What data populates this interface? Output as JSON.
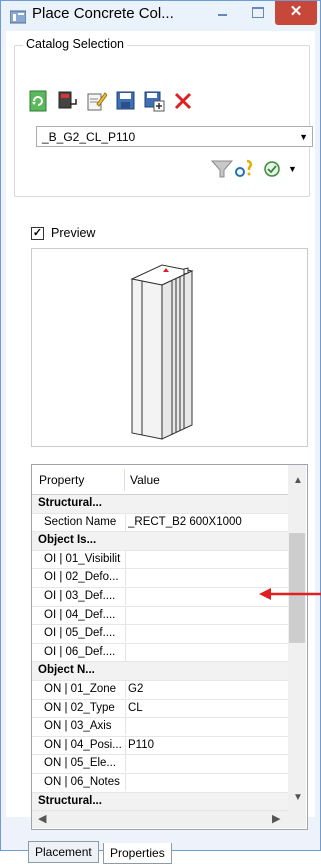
{
  "window": {
    "title": "Place Concrete Col...",
    "close_glyph": "✕"
  },
  "catalog": {
    "legend": "Catalog Selection",
    "selected": "_B_G2_CL_P110",
    "toolbar_icons": [
      "refresh-catalog-icon",
      "catalog-book-icon",
      "edit-catalog-icon",
      "save-icon",
      "save-as-icon",
      "delete-icon"
    ],
    "filter_icons": [
      "funnel-filter-icon",
      "query-icon",
      "options-icon"
    ]
  },
  "preview": {
    "label": "Preview",
    "checked": "✓"
  },
  "grid": {
    "col_property": "Property",
    "col_value": "Value",
    "rows": [
      {
        "type": "cat",
        "name": "Structural...",
        "value": ""
      },
      {
        "type": "prop",
        "name": "Section Name",
        "value": "_RECT_B2 600X1000"
      },
      {
        "type": "cat",
        "name": "Object Is...",
        "value": ""
      },
      {
        "type": "prop",
        "name": "OI | 01_Visibilit",
        "value": ""
      },
      {
        "type": "prop",
        "name": "OI | 02_Defo...",
        "value": ""
      },
      {
        "type": "prop",
        "name": "OI | 03_Def....",
        "value": ""
      },
      {
        "type": "prop",
        "name": "OI | 04_Def....",
        "value": ""
      },
      {
        "type": "prop",
        "name": "OI | 05_Def....",
        "value": ""
      },
      {
        "type": "prop",
        "name": "OI | 06_Def....",
        "value": ""
      },
      {
        "type": "cat",
        "name": "Object N...",
        "value": ""
      },
      {
        "type": "prop",
        "name": "ON | 01_Zone",
        "value": "G2"
      },
      {
        "type": "prop",
        "name": "ON | 02_Type",
        "value": "CL"
      },
      {
        "type": "prop",
        "name": "ON | 03_Axis",
        "value": ""
      },
      {
        "type": "prop",
        "name": "ON | 04_Posi...",
        "value": "P110"
      },
      {
        "type": "prop",
        "name": "ON | 05_Ele...",
        "value": ""
      },
      {
        "type": "prop",
        "name": "ON | 06_Notes",
        "value": ""
      },
      {
        "type": "cat",
        "name": "Structural...",
        "value": ""
      }
    ]
  },
  "tabs": {
    "placement": "Placement",
    "properties": "Properties"
  },
  "colors": {
    "accent_red": "#e02020",
    "title_bg": "#eaf2fc",
    "close_red": "#c7473a"
  }
}
